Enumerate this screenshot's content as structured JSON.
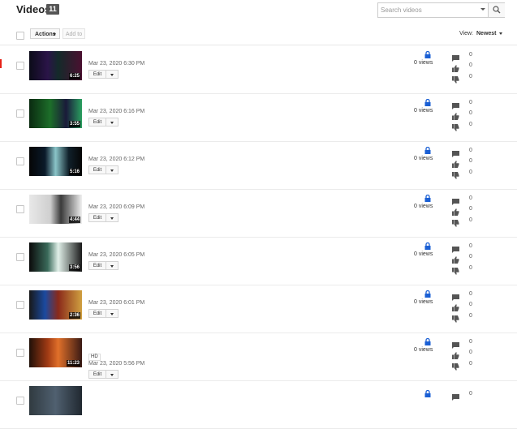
{
  "header": {
    "title": "Videos",
    "count": "11",
    "search_placeholder": "Search videos"
  },
  "toolbar": {
    "actions_label": "Actions",
    "add_to_label": "Add to",
    "view_label": "View:",
    "view_value": "Newest"
  },
  "videos": [
    {
      "date": "Mar 23, 2020 6:30 PM",
      "duration": "6:25",
      "hd": "",
      "edit": "Edit",
      "views": "0 views",
      "comments": "0",
      "likes": "0",
      "dislikes": "0"
    },
    {
      "date": "Mar 23, 2020 6:16 PM",
      "duration": "3:55",
      "hd": "",
      "edit": "Edit",
      "views": "0 views",
      "comments": "0",
      "likes": "0",
      "dislikes": "0"
    },
    {
      "date": "Mar 23, 2020 6:12 PM",
      "duration": "5:16",
      "hd": "",
      "edit": "Edit",
      "views": "0 views",
      "comments": "0",
      "likes": "0",
      "dislikes": "0"
    },
    {
      "date": "Mar 23, 2020 6:09 PM",
      "duration": "4:44",
      "hd": "",
      "edit": "Edit",
      "views": "0 views",
      "comments": "0",
      "likes": "0",
      "dislikes": "0"
    },
    {
      "date": "Mar 23, 2020 6:05 PM",
      "duration": "3:56",
      "hd": "",
      "edit": "Edit",
      "views": "0 views",
      "comments": "0",
      "likes": "0",
      "dislikes": "0"
    },
    {
      "date": "Mar 23, 2020 6:01 PM",
      "duration": "2:36",
      "hd": "",
      "edit": "Edit",
      "views": "0 views",
      "comments": "0",
      "likes": "0",
      "dislikes": "0"
    },
    {
      "date": "Mar 23, 2020 5:56 PM",
      "duration": "11:23",
      "hd": "HD",
      "edit": "Edit",
      "views": "0 views",
      "comments": "0",
      "likes": "0",
      "dislikes": "0"
    },
    {
      "date": "",
      "duration": "",
      "hd": "",
      "edit": "",
      "views": "",
      "comments": "0",
      "likes": "",
      "dislikes": ""
    }
  ],
  "icons": {
    "privacy": "lock-icon",
    "comments": "comment-icon",
    "likes": "thumbs-up-icon",
    "dislikes": "thumbs-down-icon",
    "search": "search-icon"
  },
  "colors": {
    "accent": "#e62117",
    "lock": "#1a5fd4",
    "count_badge": "#555555",
    "icon_gray": "#555555"
  }
}
